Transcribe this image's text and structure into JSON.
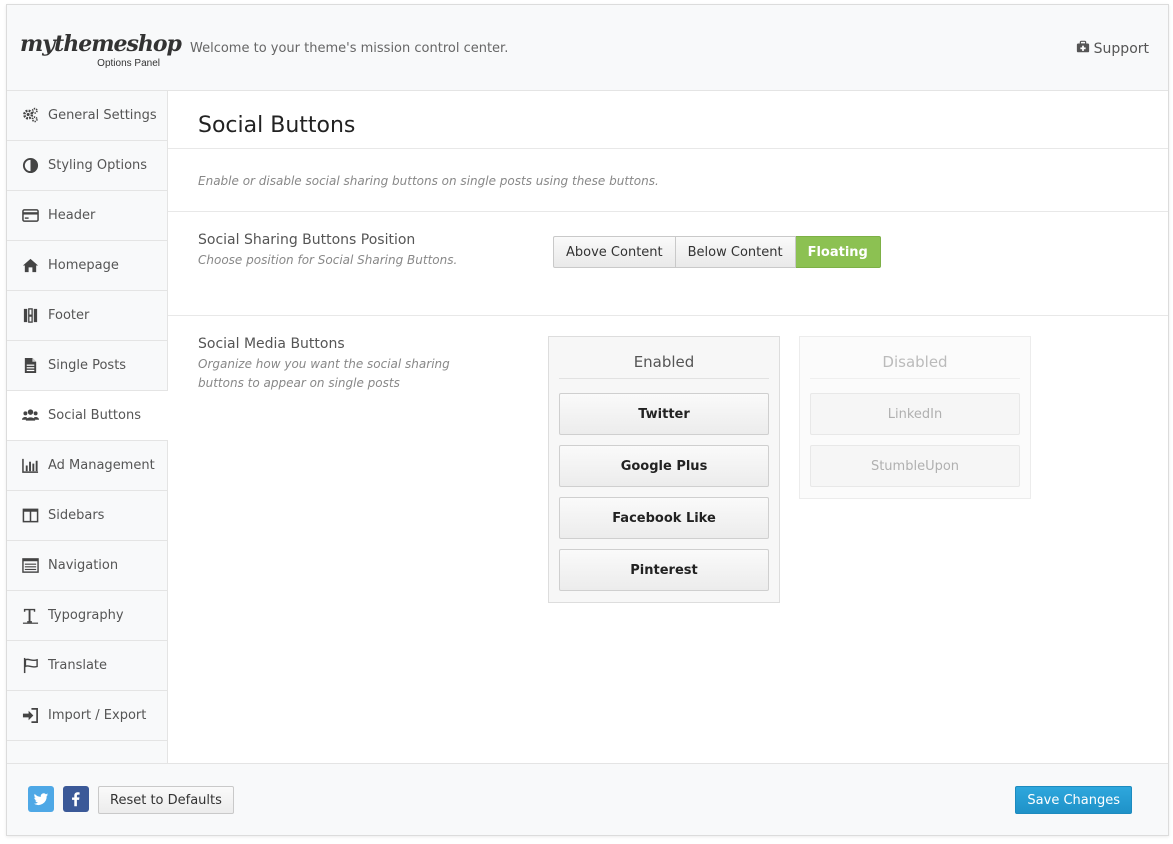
{
  "header": {
    "logo_text": "mythemeshop",
    "logo_sub": "Options Panel",
    "welcome": "Welcome to your theme's mission control center.",
    "support_label": "Support",
    "support_icon": "medkit-icon"
  },
  "sidebar": {
    "active_index": 6,
    "items": [
      {
        "label": "General Settings",
        "icon": "gears-icon"
      },
      {
        "label": "Styling Options",
        "icon": "contrast-icon"
      },
      {
        "label": "Header",
        "icon": "credit-card-icon"
      },
      {
        "label": "Homepage",
        "icon": "home-icon"
      },
      {
        "label": "Footer",
        "icon": "columns-bars-icon"
      },
      {
        "label": "Single Posts",
        "icon": "file-text-icon"
      },
      {
        "label": "Social Buttons",
        "icon": "users-icon"
      },
      {
        "label": "Ad Management",
        "icon": "bar-chart-icon"
      },
      {
        "label": "Sidebars",
        "icon": "sidebar-layout-icon"
      },
      {
        "label": "Navigation",
        "icon": "list-icon"
      },
      {
        "label": "Typography",
        "icon": "text-height-icon"
      },
      {
        "label": "Translate",
        "icon": "flag-icon"
      },
      {
        "label": "Import / Export",
        "icon": "sign-in-icon"
      }
    ]
  },
  "main": {
    "title": "Social Buttons",
    "description": "Enable or disable social sharing buttons on single posts using these buttons.",
    "position_option": {
      "title": "Social Sharing Buttons Position",
      "subtitle": "Choose position for Social Sharing Buttons.",
      "choices": [
        "Above Content",
        "Below Content",
        "Floating"
      ],
      "selected": "Floating"
    },
    "media_option": {
      "title": "Social Media Buttons",
      "subtitle": "Organize how you want the social sharing buttons to appear on single posts",
      "enabled_heading": "Enabled",
      "enabled": [
        "Twitter",
        "Google Plus",
        "Facebook Like",
        "Pinterest"
      ],
      "disabled_heading": "Disabled",
      "disabled": [
        "LinkedIn",
        "StumbleUpon"
      ]
    }
  },
  "footer": {
    "twitter_icon": "twitter-icon",
    "facebook_icon": "facebook-icon",
    "reset_label": "Reset to Defaults",
    "save_label": "Save Changes"
  },
  "colors": {
    "accent_green": "#8cc152",
    "save_blue": "#1f92c8",
    "twitter_blue": "#4ea8e6",
    "facebook_blue": "#3b5998"
  }
}
